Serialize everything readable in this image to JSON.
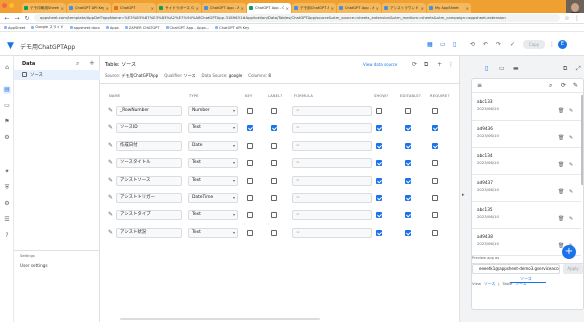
{
  "browser": {
    "tabs": [
      {
        "label": "デモ印刷用Sheets & Forms...",
        "active": false
      },
      {
        "label": "ChatGPT API Key - AppS...",
        "active": false
      },
      {
        "label": "ChatGPT",
        "active": false
      },
      {
        "label": "サイドラボース Google Dr...",
        "active": false
      },
      {
        "label": "ChatGPT App - AppSheet",
        "active": false
      },
      {
        "label": "ChatGPT App - Google...",
        "active": true
      },
      {
        "label": "デモ用ChatGPT App",
        "active": false
      },
      {
        "label": "ChatGPT App - AppSheet",
        "active": false
      },
      {
        "label": "アシストラウンド - AppShe...",
        "active": false
      },
      {
        "label": "My AppSheet",
        "active": false
      }
    ],
    "url": "appsheet.com/template/AppDef?appName=%E3%83%87%E3%83%A2%E7%94%A8ChatGPTApp-3189631#Application/Data/Tables/ChatGPTApp/source&utm_source=sheets_extension&utm_medium=sheets&utm_campaign=appsheet-extension",
    "bookmarks": [
      "AppSheet",
      "Google スライド",
      "appsheet docs",
      "Apps",
      "ZAPIER CHATGPT",
      "ChatGPT App - Apps...",
      "ChatGPT API Key"
    ]
  },
  "app": {
    "title": "デモ用ChatGPTApp",
    "copy_label": "Copy",
    "avatar_letter": "E"
  },
  "data_panel": {
    "title": "Data",
    "items": [
      {
        "label": "ソース"
      }
    ],
    "section_label": "Settings",
    "settings_label": "User settings"
  },
  "editor": {
    "title": "Table: ソース",
    "view_source": "View data source",
    "meta": {
      "source_label": "Source:",
      "source_value": "デモ用ChatGPTApp",
      "qualifier_label": "Qualifier:",
      "qualifier_value": "ソース",
      "datasource_label": "Data Source:",
      "datasource_value": "google",
      "columns_label": "Columns:",
      "columns_value": "8"
    },
    "columns": [
      "NAME",
      "TYPE",
      "KEY",
      "LABEL?",
      "FORMULA",
      "SHOW?",
      "EDITABLE?",
      "REQUIRE?"
    ],
    "rows": [
      {
        "name": "_RowNumber",
        "type": "Number",
        "key": false,
        "label": false,
        "formula": "=",
        "show": false,
        "editable": false,
        "require": false
      },
      {
        "name": "ソースID",
        "type": "Text",
        "key": true,
        "label": true,
        "formula": "=",
        "show": true,
        "editable": true,
        "require": true
      },
      {
        "name": "作成日付",
        "type": "Date",
        "key": false,
        "label": false,
        "formula": "=",
        "show": true,
        "editable": true,
        "require": true
      },
      {
        "name": "ソースタイトル",
        "type": "Text",
        "key": false,
        "label": false,
        "formula": "=",
        "show": true,
        "editable": true,
        "require": false
      },
      {
        "name": "アシストソース",
        "type": "Text",
        "key": false,
        "label": false,
        "formula": "=",
        "show": true,
        "editable": true,
        "require": false
      },
      {
        "name": "アシストトリガー",
        "type": "DateTime",
        "key": false,
        "label": false,
        "formula": "=",
        "show": true,
        "editable": true,
        "require": false
      },
      {
        "name": "アシストタイプ",
        "type": "Text",
        "key": false,
        "label": false,
        "formula": "=",
        "show": true,
        "editable": true,
        "require": false
      },
      {
        "name": "アシスト状況",
        "type": "Text",
        "key": false,
        "label": false,
        "formula": "=",
        "show": true,
        "editable": true,
        "require": false
      }
    ]
  },
  "preview": {
    "items": [
      {
        "id": "abc133",
        "date": "2023/06/10"
      },
      {
        "id": "ad9436",
        "date": "2023/06/10"
      },
      {
        "id": "abc134",
        "date": "2023/06/10"
      },
      {
        "id": "ad9437",
        "date": "2023/06/10"
      },
      {
        "id": "abc135",
        "date": "2023/06/10"
      },
      {
        "id": "ad9438",
        "date": "2023/06/10"
      }
    ],
    "nav_label": "ソース",
    "preview_as_label": "Preview app as",
    "preview_as_value": "eeeetk1@appsheet-demo3.gserviceaccount.com",
    "apply_label": "Apply",
    "crumb_view": "View",
    "crumb_view_value": "ソース",
    "crumb_table": "Table",
    "crumb_table_value": "ソース"
  },
  "colors": {
    "accent": "#1a73e8",
    "tabbar": "#f0a030",
    "selected_bg": "#e8f0fe"
  },
  "icons": {
    "logo": "appsheet-logo-icon",
    "search": "search-icon",
    "add": "add-icon",
    "edit": "edit-pencil-icon",
    "delete": "trash-icon",
    "fab": "plus-icon"
  }
}
